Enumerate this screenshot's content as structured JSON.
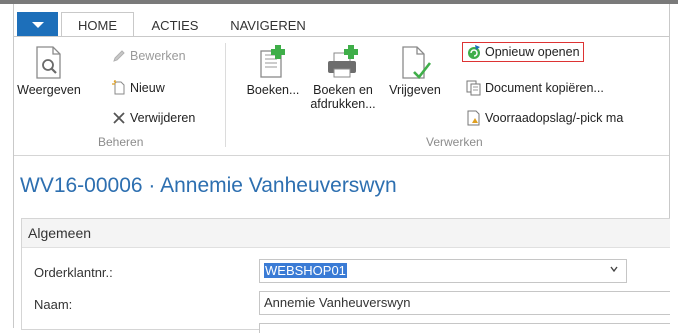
{
  "tabs": [
    {
      "label": "HOME",
      "active": true
    },
    {
      "label": "ACTIES",
      "active": false
    },
    {
      "label": "NAVIGEREN",
      "active": false
    }
  ],
  "ribbon": {
    "beheren": {
      "group_label": "Beheren",
      "weergeven": "Weergeven",
      "bewerken": "Bewerken",
      "nieuw": "Nieuw",
      "verwijderen": "Verwijderen"
    },
    "verwerken": {
      "group_label": "Verwerken",
      "boeken": "Boeken...",
      "boeken_afdrukken_1": "Boeken en",
      "boeken_afdrukken_2": "afdrukken...",
      "vrijgeven": "Vrijgeven",
      "opnieuw_openen": "Opnieuw openen",
      "document_kopieren": "Document kopiëren...",
      "voorraadopslag": "Voorraadopslag/-pick ma"
    }
  },
  "page_title": "WV16-00006 · Annemie Vanheuverswyn",
  "section": {
    "title": "Algemeen",
    "fields": [
      {
        "label": "Orderklantnr.:",
        "value": "WEBSHOP01"
      },
      {
        "label": "Naam:",
        "value": "Annemie Vanheuverswyn"
      }
    ]
  },
  "colors": {
    "accent": "#1d6fba",
    "title": "#2d6fb0",
    "highlight_border": "#dd3333"
  }
}
